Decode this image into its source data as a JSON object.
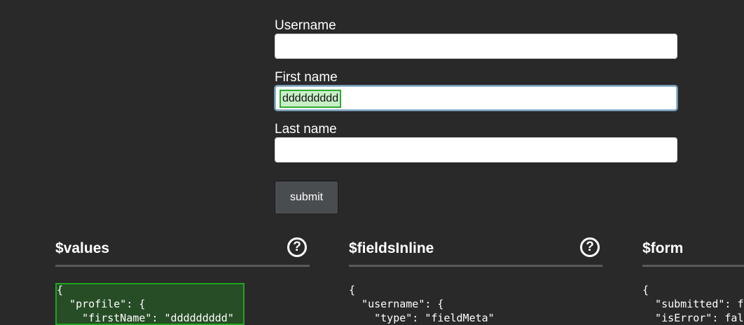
{
  "form": {
    "fields": [
      {
        "label": "Username",
        "value": "",
        "placeholder": ""
      },
      {
        "label": "First name",
        "value": "ddddddddd",
        "placeholder": ""
      },
      {
        "label": "Last name",
        "value": "",
        "placeholder": ""
      }
    ],
    "submit_label": "submit"
  },
  "panels": [
    {
      "title": "$values",
      "code": "{\n  \"profile\": {\n    \"firstName\": \"ddddddddd\""
    },
    {
      "title": "$fieldsInline",
      "code": "{\n  \"username\": {\n    \"type\": \"fieldMeta\""
    },
    {
      "title": "$form",
      "code": "{\n  \"submitted\": false,\n  \"isError\": false"
    }
  ],
  "help_icon_glyph": "?",
  "colors": {
    "background": "#292929",
    "highlight_border": "#1fa51f",
    "highlight_fill": "#264d26",
    "input_focus_ring": "#8fb0c8",
    "button_bg": "#4a4d50"
  }
}
